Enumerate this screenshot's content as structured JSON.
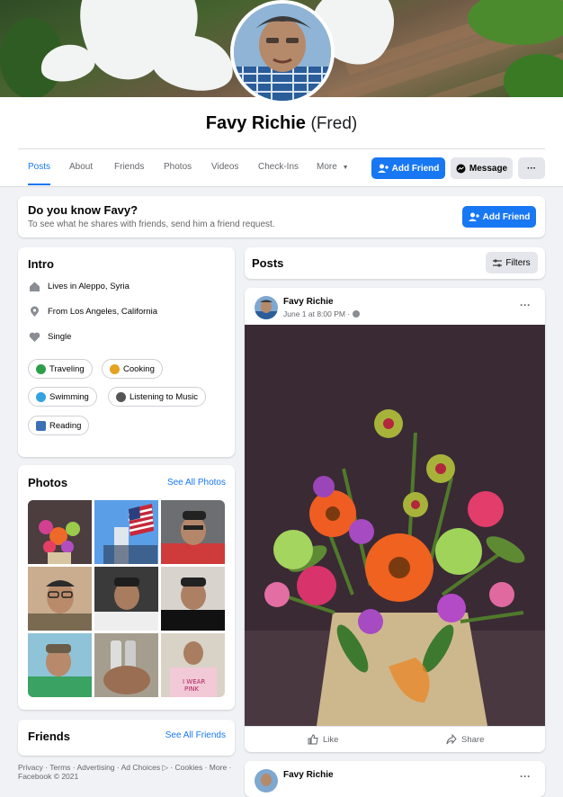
{
  "profile": {
    "name": "Favy Richie",
    "alt_name": "(Fred)"
  },
  "tabs": [
    {
      "label": "Posts"
    },
    {
      "label": "About"
    },
    {
      "label": "Friends"
    },
    {
      "label": "Photos"
    },
    {
      "label": "Videos"
    },
    {
      "label": "Check-Ins"
    },
    {
      "label": "More"
    }
  ],
  "actions": {
    "add_friend": "Add Friend",
    "message": "Message",
    "more_dots": "···"
  },
  "know_card": {
    "title": "Do you know Favy?",
    "subtitle": "To see what he shares with friends, send him a friend request.",
    "button": "Add Friend"
  },
  "intro": {
    "title": "Intro",
    "rows": [
      {
        "prefix": "Lives in",
        "value": "Aleppo, Syria",
        "icon": "home-icon"
      },
      {
        "prefix": "From",
        "value": "Los Angeles, California",
        "icon": "location-icon"
      },
      {
        "prefix": "",
        "value": "Single",
        "icon": "heart-icon"
      }
    ],
    "hobbies": [
      {
        "label": "Traveling",
        "icon": "globe-icon",
        "color": "#2e9d4b"
      },
      {
        "label": "Cooking",
        "icon": "cooking-icon",
        "color": "#e3a220"
      },
      {
        "label": "Swimming",
        "icon": "swimming-icon",
        "color": "#35a3e0"
      },
      {
        "label": "Listening to Music",
        "icon": "headphones-icon",
        "color": "#555"
      },
      {
        "label": "Reading",
        "icon": "book-icon",
        "color": "#3b6fb6"
      }
    ]
  },
  "photos": {
    "title": "Photos",
    "see_all": "See All Photos"
  },
  "friends": {
    "title": "Friends",
    "see_all": "See All Friends"
  },
  "posts": {
    "title": "Posts",
    "filters": "Filters",
    "post": {
      "author": "Favy Richie",
      "time": "June 1 at 8:00 PM ·",
      "like": "Like",
      "share": "Share"
    },
    "next_author": "Favy Richie"
  },
  "footer": {
    "line1": "Privacy · Terms · Advertising · Ad Choices ▷ · Cookies · More ·",
    "line2": "Facebook © 2021"
  },
  "colors": {
    "accent": "#1877f2",
    "background": "#f0f2f5"
  }
}
